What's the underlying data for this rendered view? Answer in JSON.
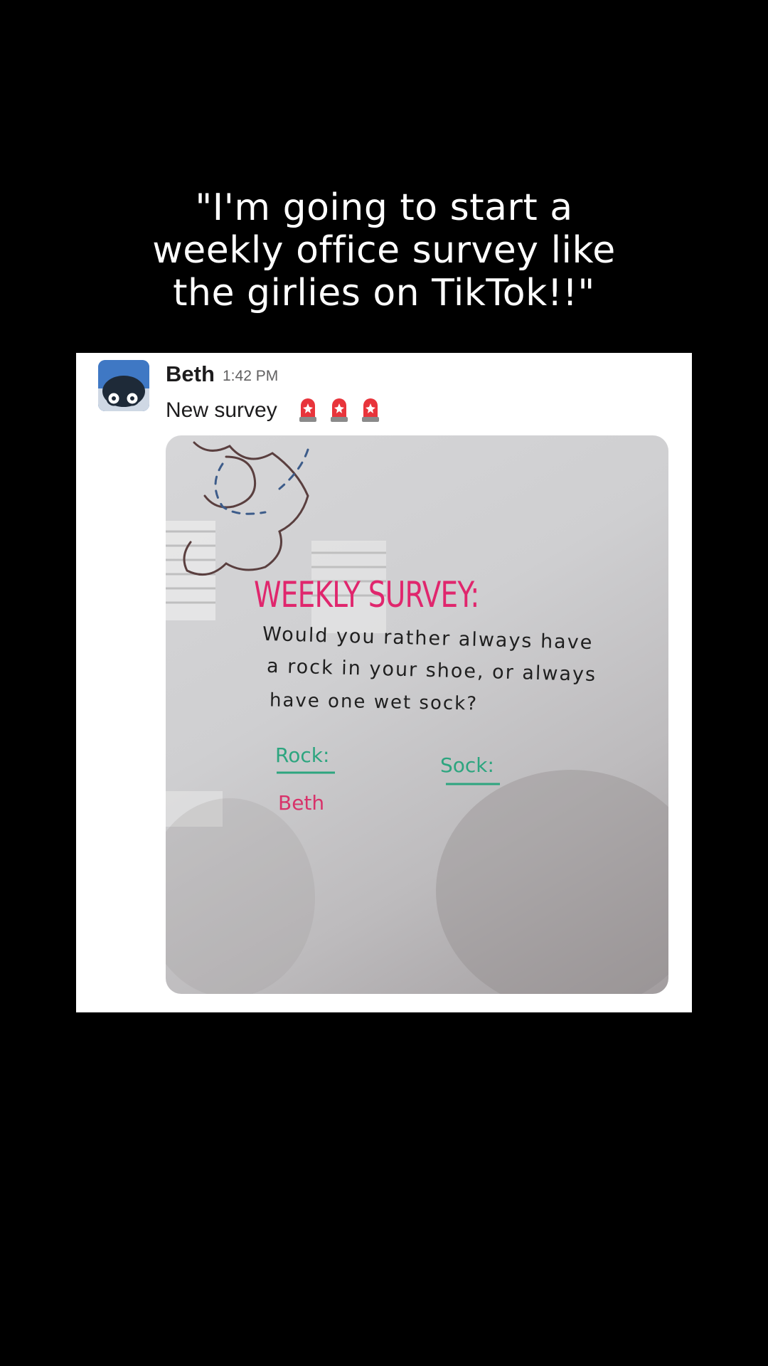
{
  "caption": {
    "line1": "\"I'm going to start a",
    "line2": "weekly office survey like",
    "line3": "the girlies on TikTok!!\""
  },
  "message": {
    "author": "Beth",
    "time": "1:42 PM",
    "text": "New survey",
    "emojis": [
      "rotating-light-icon",
      "rotating-light-icon",
      "rotating-light-icon"
    ]
  },
  "whiteboard": {
    "title": "WEEKLY SURVEY:",
    "question_lines": [
      "Would you rather always have",
      "a rock in your shoe, or always",
      "have one wet sock?"
    ],
    "option_rock": "Rock:",
    "option_sock": "Sock:",
    "rock_votes": [
      "Beth"
    ]
  },
  "colors": {
    "background": "#000000",
    "card": "#ffffff",
    "title_pink": "#e0266d",
    "option_green": "#2da57f"
  }
}
